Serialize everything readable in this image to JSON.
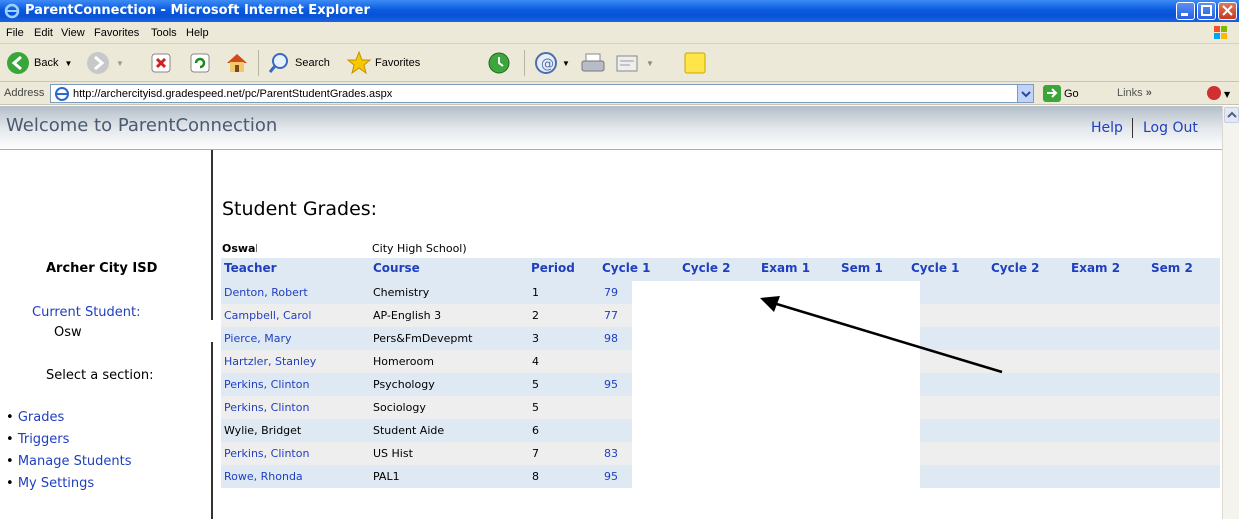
{
  "window": {
    "title": "ParentConnection - Microsoft Internet Explorer"
  },
  "menu": [
    "File",
    "Edit",
    "View",
    "Favorites",
    "Tools",
    "Help"
  ],
  "toolbar": {
    "back": "Back",
    "search": "Search",
    "favorites": "Favorites"
  },
  "address": {
    "label": "Address",
    "url": "http://archercityisd.gradespeed.net/pc/ParentStudentGrades.aspx",
    "go": "Go",
    "links": "Links"
  },
  "header": {
    "welcome": "Welcome to ParentConnection",
    "help": "Help",
    "logout": "Log Out"
  },
  "sidebar": {
    "district": "Archer City ISD",
    "current_student_label": "Current Student:",
    "current_student_value": "Osw",
    "select_section": "Select a section:",
    "nav": [
      "Grades",
      "Triggers",
      "Manage Students",
      "My Settings"
    ]
  },
  "main": {
    "title": "Student Grades:",
    "student_name": "Oswal",
    "school": "City High School)"
  },
  "grades": {
    "columns": [
      "Teacher",
      "Course",
      "Period",
      "Cycle 1",
      "Cycle 2",
      "Exam 1",
      "Sem 1",
      "Cycle 1",
      "Cycle 2",
      "Exam 2",
      "Sem 2"
    ],
    "rows": [
      {
        "teacher": "Denton, Robert",
        "teacher_link": true,
        "course": "Chemistry",
        "period": "1",
        "cycle1": "79"
      },
      {
        "teacher": "Campbell, Carol",
        "teacher_link": true,
        "course": "AP-English 3",
        "period": "2",
        "cycle1": "77"
      },
      {
        "teacher": "Pierce, Mary",
        "teacher_link": true,
        "course": "Pers&FmDevepmt",
        "period": "3",
        "cycle1": "98"
      },
      {
        "teacher": "Hartzler, Stanley",
        "teacher_link": true,
        "course": "Homeroom",
        "period": "4",
        "cycle1": ""
      },
      {
        "teacher": "Perkins, Clinton",
        "teacher_link": true,
        "course": "Psychology",
        "period": "5",
        "cycle1": "95"
      },
      {
        "teacher": "Perkins, Clinton",
        "teacher_link": true,
        "course": "Sociology",
        "period": "5",
        "cycle1": ""
      },
      {
        "teacher": "Wylie, Bridget",
        "teacher_link": false,
        "course": "Student Aide",
        "period": "6",
        "cycle1": ""
      },
      {
        "teacher": "Perkins, Clinton",
        "teacher_link": true,
        "course": "US Hist",
        "period": "7",
        "cycle1": "83"
      },
      {
        "teacher": "Rowe, Rhonda",
        "teacher_link": true,
        "course": "PAL1",
        "period": "8",
        "cycle1": "95"
      }
    ]
  },
  "colors": {
    "link": "#1f3fbf",
    "row_blue": "#dfe9f3",
    "row_gray": "#eeeeee",
    "titlebar": "#0a5ae0"
  }
}
